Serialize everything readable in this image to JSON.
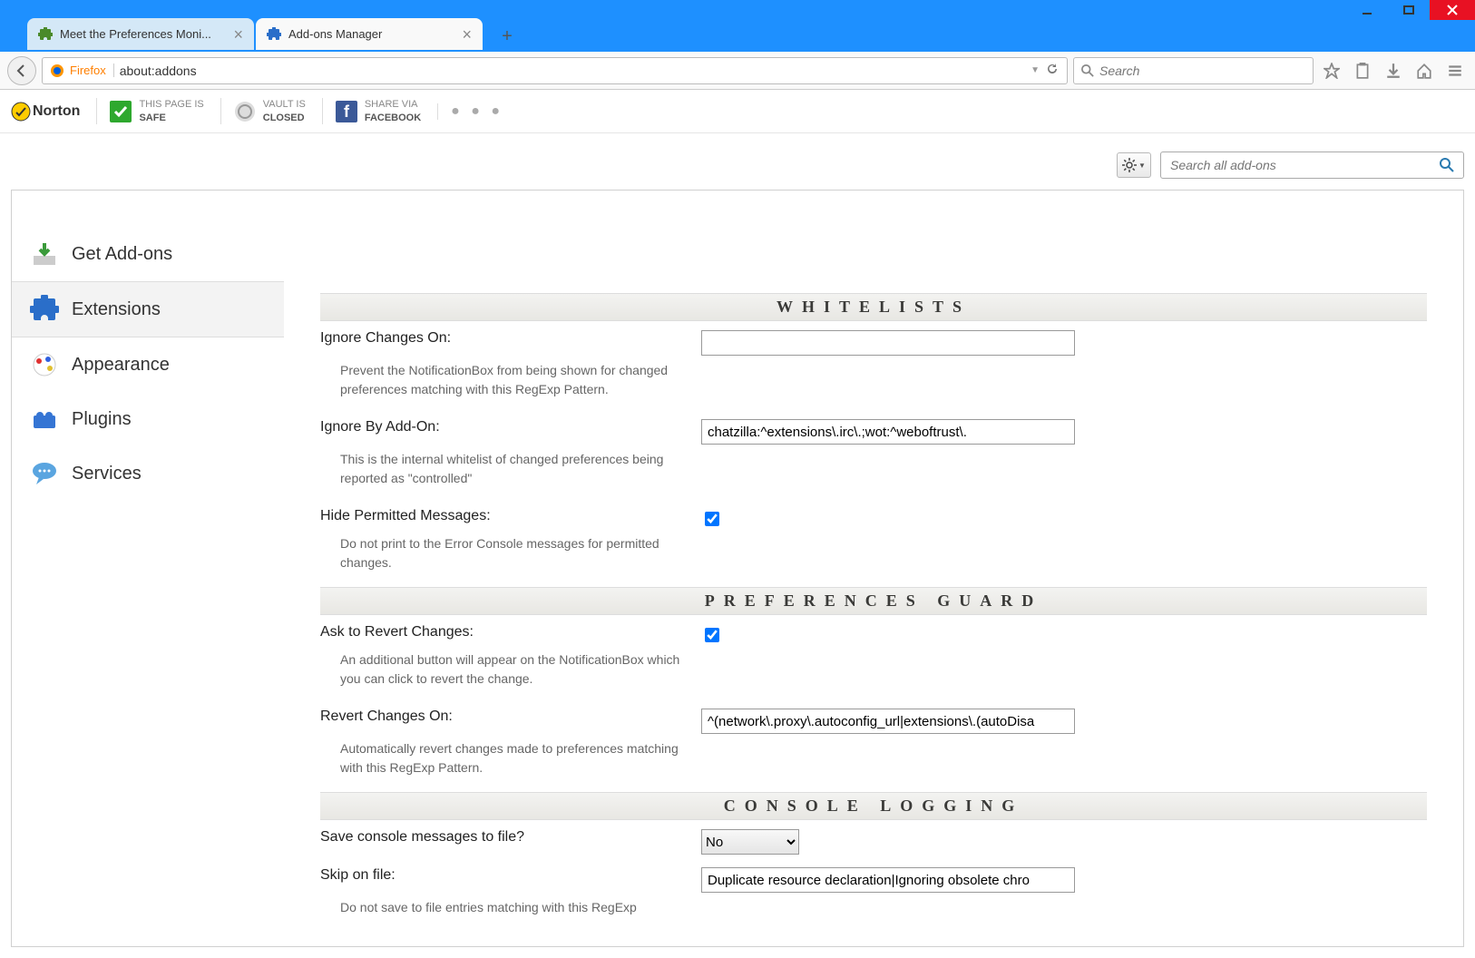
{
  "tabs": [
    {
      "title": "Meet the Preferences Moni..."
    },
    {
      "title": "Add-ons Manager"
    }
  ],
  "urlbar": {
    "brand": "Firefox",
    "url": "about:addons"
  },
  "searchbar": {
    "placeholder": "Search"
  },
  "norton": {
    "logo": "Norton",
    "page_safe_label": "THIS PAGE IS",
    "page_safe_value": "SAFE",
    "vault_label": "VAULT IS",
    "vault_value": "CLOSED",
    "share_label": "SHARE VIA",
    "share_value": "FACEBOOK"
  },
  "addons_toolbar": {
    "search_placeholder": "Search all add-ons"
  },
  "sidebar": {
    "items": [
      {
        "label": "Get Add-ons"
      },
      {
        "label": "Extensions"
      },
      {
        "label": "Appearance"
      },
      {
        "label": "Plugins"
      },
      {
        "label": "Services"
      }
    ]
  },
  "sections": {
    "whitelists": {
      "title": "WHITELISTS",
      "ignore_changes": {
        "label": "Ignore Changes On:",
        "desc": "Prevent the NotificationBox from being shown for changed preferences matching with this RegExp Pattern.",
        "value": ""
      },
      "ignore_by_addon": {
        "label": "Ignore By Add-On:",
        "desc": "This is the internal whitelist of changed preferences being reported as \"controlled\"",
        "value": "chatzilla:^extensions\\.irc\\.;wot:^weboftrust\\."
      },
      "hide_permitted": {
        "label": "Hide Permitted Messages:",
        "desc": "Do not print to the Error Console messages for permitted changes.",
        "checked": true
      }
    },
    "guard": {
      "title": "PREFERENCES GUARD",
      "ask_revert": {
        "label": "Ask to Revert Changes:",
        "desc": "An additional button will appear on the NotificationBox which you can click to revert the change.",
        "checked": true
      },
      "revert_on": {
        "label": "Revert Changes On:",
        "desc": "Automatically revert changes made to preferences matching with this RegExp Pattern.",
        "value": "^(network\\.proxy\\.autoconfig_url|extensions\\.(autoDisa"
      }
    },
    "console": {
      "title": "CONSOLE LOGGING",
      "save_file": {
        "label": "Save console messages to file?",
        "value": "No"
      },
      "skip_file": {
        "label": "Skip on file:",
        "desc": "Do not save to file entries matching with this RegExp",
        "value": "Duplicate resource declaration|Ignoring obsolete chro"
      }
    }
  }
}
